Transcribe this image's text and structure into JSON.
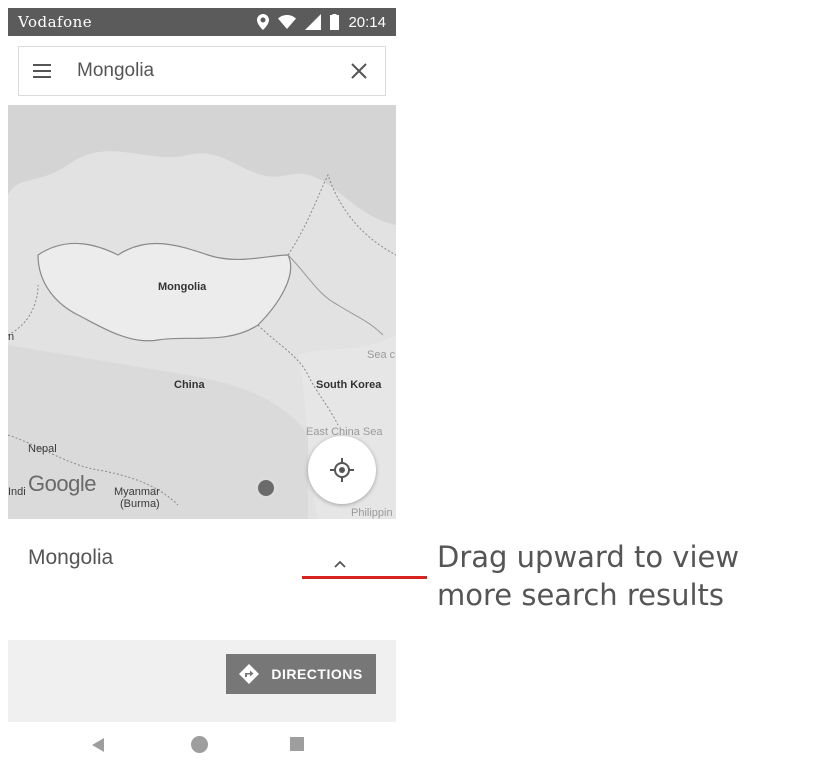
{
  "status_bar": {
    "carrier": "Vodafone",
    "time": "20:14"
  },
  "search": {
    "query": "Mongolia"
  },
  "map": {
    "labels": {
      "mongolia": "Mongolia",
      "china": "China",
      "south_korea": "South Korea",
      "east_china_sea": "East China Sea",
      "nepal": "Nepal",
      "myanmar_1": "Myanmar",
      "myanmar_2": "(Burma)",
      "sea_of_japan_partial": "Sea c",
      "india_partial": "Indi",
      "philippines_partial": "Philippin",
      "left_partial": "n"
    },
    "logo": "Google"
  },
  "result": {
    "title": "Mongolia"
  },
  "actions": {
    "directions_label": "DIRECTIONS"
  },
  "annotation": {
    "text": "Drag upward to view more search results"
  },
  "colors": {
    "annotation_line": "#d7231f",
    "status_bar": "#5b5b5b",
    "directions_button": "#777777"
  }
}
